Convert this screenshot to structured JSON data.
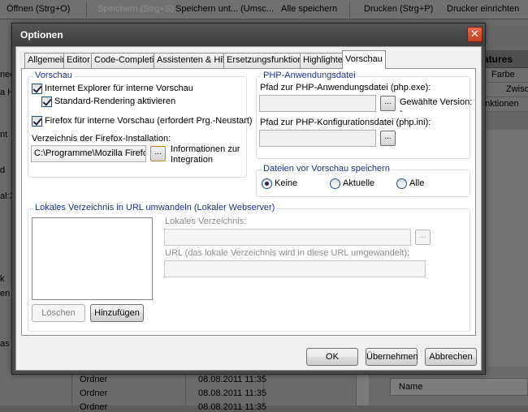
{
  "background": {
    "toolbar_items": [
      {
        "label": "Öffnen (Strg+O)",
        "disabled": false
      },
      {
        "label": "Speichern (Strg+S)",
        "disabled": true
      },
      {
        "label": "Speichern unt... (Umsc...",
        "disabled": false
      },
      {
        "label": "Alle speichern",
        "disabled": false
      },
      {
        "label": "Drucken (Strg+P)",
        "disabled": false
      },
      {
        "label": "Drucker einrichten",
        "disabled": false
      }
    ],
    "left_fragments": [
      "neck",
      "a H",
      "nt",
      "d",
      "al:3",
      "k",
      "en",
      "as Pr"
    ],
    "right_panel": {
      "header": "atures",
      "rows": [
        "Farbe",
        "Zwisch",
        "unktionen"
      ]
    },
    "file_rows": [
      {
        "type": "Ordner",
        "date": "08.08.2011 11:35"
      },
      {
        "type": "Ordner",
        "date": "08.08.2011 11:35"
      },
      {
        "type": "Ordner",
        "date": "08.08.2011 11:35"
      }
    ],
    "name_column": "Name"
  },
  "dialog": {
    "title": "Optionen",
    "close_glyph": "✕",
    "tabs": [
      "Allgemein",
      "Editor",
      "Code-Completion",
      "Assistenten & Hilfen",
      "Ersetzungsfunktionen",
      "Highlighter",
      "Vorschau"
    ],
    "active_tab": "Vorschau",
    "preview": {
      "title": "Vorschau",
      "ie_label": "Internet Explorer für interne Vorschau",
      "ie_checked": true,
      "std_render_label": "Standard-Rendering aktivieren",
      "std_render_checked": true,
      "firefox_label": "Firefox für interne Vorschau (erfordert Prg.-Neustart)",
      "firefox_checked": true,
      "firefox_dir_label": "Verzeichnis der Firefox-Installation:",
      "firefox_dir_value": "C:\\Programme\\Mozilla Firefox\\",
      "browse_glyph": "...",
      "info_label_1": "Informationen zur",
      "info_label_2": "Integration"
    },
    "php": {
      "title": "PHP-Anwendungsdatei",
      "exe_label": "Pfad zur PHP-Anwendungsdatei (php.exe):",
      "exe_value": "",
      "version_label": "Gewählte Version:",
      "version_value": "-",
      "ini_label": "Pfad zur PHP-Konfigurationsdatei (php.ini):",
      "ini_value": "",
      "browse_glyph": "..."
    },
    "save_before": {
      "title": "Dateien vor Vorschau speichern",
      "options": [
        "Keine",
        "Aktuelle",
        "Alle"
      ],
      "selected": "Keine"
    },
    "local_dir": {
      "title": "Lokales Verzeichnis in URL umwandeln (Lokaler Webserver)",
      "dir_label": "Lokales Verzeichnis:",
      "dir_value": "",
      "url_label": "URL (das lokale Verzeichnis wird in diese URL umgewandelt):",
      "url_value": "",
      "browse_glyph": "...",
      "delete_label": "Löschen",
      "add_label": "Hinzufügen"
    },
    "buttons": {
      "ok": "OK",
      "apply": "Übernehmen",
      "cancel": "Abbrechen"
    }
  }
}
